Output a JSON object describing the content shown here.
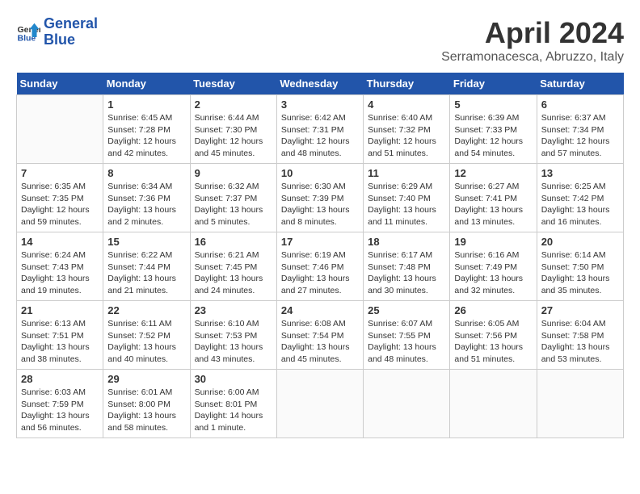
{
  "header": {
    "logo_line1": "General",
    "logo_line2": "Blue",
    "title": "April 2024",
    "location": "Serramonacesca, Abruzzo, Italy"
  },
  "days_of_week": [
    "Sunday",
    "Monday",
    "Tuesday",
    "Wednesday",
    "Thursday",
    "Friday",
    "Saturday"
  ],
  "weeks": [
    [
      {
        "day": "",
        "info": ""
      },
      {
        "day": "1",
        "info": "Sunrise: 6:45 AM\nSunset: 7:28 PM\nDaylight: 12 hours\nand 42 minutes."
      },
      {
        "day": "2",
        "info": "Sunrise: 6:44 AM\nSunset: 7:30 PM\nDaylight: 12 hours\nand 45 minutes."
      },
      {
        "day": "3",
        "info": "Sunrise: 6:42 AM\nSunset: 7:31 PM\nDaylight: 12 hours\nand 48 minutes."
      },
      {
        "day": "4",
        "info": "Sunrise: 6:40 AM\nSunset: 7:32 PM\nDaylight: 12 hours\nand 51 minutes."
      },
      {
        "day": "5",
        "info": "Sunrise: 6:39 AM\nSunset: 7:33 PM\nDaylight: 12 hours\nand 54 minutes."
      },
      {
        "day": "6",
        "info": "Sunrise: 6:37 AM\nSunset: 7:34 PM\nDaylight: 12 hours\nand 57 minutes."
      }
    ],
    [
      {
        "day": "7",
        "info": "Sunrise: 6:35 AM\nSunset: 7:35 PM\nDaylight: 12 hours\nand 59 minutes."
      },
      {
        "day": "8",
        "info": "Sunrise: 6:34 AM\nSunset: 7:36 PM\nDaylight: 13 hours\nand 2 minutes."
      },
      {
        "day": "9",
        "info": "Sunrise: 6:32 AM\nSunset: 7:37 PM\nDaylight: 13 hours\nand 5 minutes."
      },
      {
        "day": "10",
        "info": "Sunrise: 6:30 AM\nSunset: 7:39 PM\nDaylight: 13 hours\nand 8 minutes."
      },
      {
        "day": "11",
        "info": "Sunrise: 6:29 AM\nSunset: 7:40 PM\nDaylight: 13 hours\nand 11 minutes."
      },
      {
        "day": "12",
        "info": "Sunrise: 6:27 AM\nSunset: 7:41 PM\nDaylight: 13 hours\nand 13 minutes."
      },
      {
        "day": "13",
        "info": "Sunrise: 6:25 AM\nSunset: 7:42 PM\nDaylight: 13 hours\nand 16 minutes."
      }
    ],
    [
      {
        "day": "14",
        "info": "Sunrise: 6:24 AM\nSunset: 7:43 PM\nDaylight: 13 hours\nand 19 minutes."
      },
      {
        "day": "15",
        "info": "Sunrise: 6:22 AM\nSunset: 7:44 PM\nDaylight: 13 hours\nand 21 minutes."
      },
      {
        "day": "16",
        "info": "Sunrise: 6:21 AM\nSunset: 7:45 PM\nDaylight: 13 hours\nand 24 minutes."
      },
      {
        "day": "17",
        "info": "Sunrise: 6:19 AM\nSunset: 7:46 PM\nDaylight: 13 hours\nand 27 minutes."
      },
      {
        "day": "18",
        "info": "Sunrise: 6:17 AM\nSunset: 7:48 PM\nDaylight: 13 hours\nand 30 minutes."
      },
      {
        "day": "19",
        "info": "Sunrise: 6:16 AM\nSunset: 7:49 PM\nDaylight: 13 hours\nand 32 minutes."
      },
      {
        "day": "20",
        "info": "Sunrise: 6:14 AM\nSunset: 7:50 PM\nDaylight: 13 hours\nand 35 minutes."
      }
    ],
    [
      {
        "day": "21",
        "info": "Sunrise: 6:13 AM\nSunset: 7:51 PM\nDaylight: 13 hours\nand 38 minutes."
      },
      {
        "day": "22",
        "info": "Sunrise: 6:11 AM\nSunset: 7:52 PM\nDaylight: 13 hours\nand 40 minutes."
      },
      {
        "day": "23",
        "info": "Sunrise: 6:10 AM\nSunset: 7:53 PM\nDaylight: 13 hours\nand 43 minutes."
      },
      {
        "day": "24",
        "info": "Sunrise: 6:08 AM\nSunset: 7:54 PM\nDaylight: 13 hours\nand 45 minutes."
      },
      {
        "day": "25",
        "info": "Sunrise: 6:07 AM\nSunset: 7:55 PM\nDaylight: 13 hours\nand 48 minutes."
      },
      {
        "day": "26",
        "info": "Sunrise: 6:05 AM\nSunset: 7:56 PM\nDaylight: 13 hours\nand 51 minutes."
      },
      {
        "day": "27",
        "info": "Sunrise: 6:04 AM\nSunset: 7:58 PM\nDaylight: 13 hours\nand 53 minutes."
      }
    ],
    [
      {
        "day": "28",
        "info": "Sunrise: 6:03 AM\nSunset: 7:59 PM\nDaylight: 13 hours\nand 56 minutes."
      },
      {
        "day": "29",
        "info": "Sunrise: 6:01 AM\nSunset: 8:00 PM\nDaylight: 13 hours\nand 58 minutes."
      },
      {
        "day": "30",
        "info": "Sunrise: 6:00 AM\nSunset: 8:01 PM\nDaylight: 14 hours\nand 1 minute."
      },
      {
        "day": "",
        "info": ""
      },
      {
        "day": "",
        "info": ""
      },
      {
        "day": "",
        "info": ""
      },
      {
        "day": "",
        "info": ""
      }
    ]
  ]
}
